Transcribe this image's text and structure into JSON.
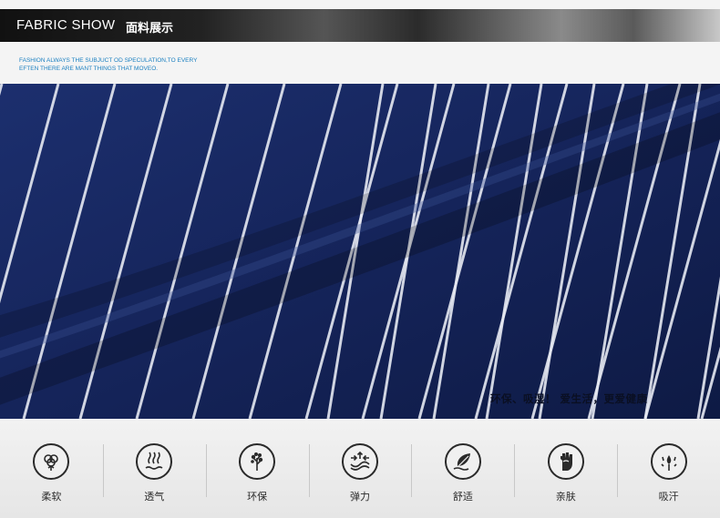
{
  "header": {
    "title_en": "FABRIC SHOW",
    "title_cn": "面料展示",
    "tagline_line1": "FASHION ALWAYS THE  SUBJUCT OD SPECULATION,TO EVERY",
    "tagline_line2": "EFTEN THERE ARE MANT THINGS THAT MOVEO."
  },
  "fabric": {
    "overlay_text": "环保、吸湿！ 爱生活，更爱健康",
    "base_color": "#15245a",
    "stripe_color": "#e6e9f2"
  },
  "features": [
    {
      "label": "柔软",
      "icon": "cotton-icon"
    },
    {
      "label": "透气",
      "icon": "breathable-icon"
    },
    {
      "label": "环保",
      "icon": "tree-icon"
    },
    {
      "label": "弹力",
      "icon": "elastic-icon"
    },
    {
      "label": "舒适",
      "icon": "feather-icon"
    },
    {
      "label": "亲肤",
      "icon": "hand-icon"
    },
    {
      "label": "吸汗",
      "icon": "sweat-drops-icon"
    }
  ]
}
